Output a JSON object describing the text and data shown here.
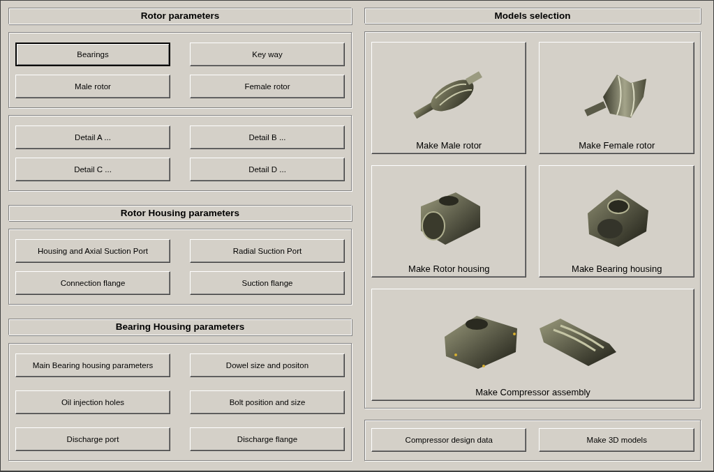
{
  "left": [
    {
      "title": "Rotor parameters",
      "groups": [
        [
          {
            "label": "Bearings",
            "default": true
          },
          {
            "label": "Key way",
            "default": false
          },
          {
            "label": "Male rotor",
            "default": false
          },
          {
            "label": "Female rotor",
            "default": false
          }
        ],
        [
          {
            "label": "Detail A ...",
            "default": false
          },
          {
            "label": "Detail B ...",
            "default": false
          },
          {
            "label": "Detail C ...",
            "default": false
          },
          {
            "label": "Detail D ...",
            "default": false
          }
        ]
      ]
    },
    {
      "title": "Rotor Housing parameters",
      "groups": [
        [
          {
            "label": "Housing and Axial Suction Port",
            "default": false
          },
          {
            "label": "Radial Suction Port",
            "default": false
          },
          {
            "label": "Connection flange",
            "default": false
          },
          {
            "label": "Suction flange",
            "default": false
          }
        ]
      ]
    },
    {
      "title": "Bearing Housing parameters",
      "groups": [
        [
          {
            "label": "Main Bearing housing parameters",
            "default": false
          },
          {
            "label": "Dowel size and positon",
            "default": false
          },
          {
            "label": "Oil injection holes",
            "default": false
          },
          {
            "label": "Bolt position and size",
            "default": false
          },
          {
            "label": "Discharge port",
            "default": false
          },
          {
            "label": "Discharge flange",
            "default": false
          }
        ]
      ]
    }
  ],
  "models": {
    "title": "Models selection",
    "tiles": [
      {
        "label": "Make Male rotor",
        "kind": "male_rotor"
      },
      {
        "label": "Make Female rotor",
        "kind": "female_rotor"
      },
      {
        "label": "Make Rotor housing",
        "kind": "rotor_housing"
      },
      {
        "label": "Make Bearing housing",
        "kind": "bearing_housing"
      },
      {
        "label": "Make Compressor assembly",
        "kind": "assembly"
      }
    ]
  },
  "bottom_buttons": [
    {
      "label": "Compressor design data",
      "default": false
    },
    {
      "label": "Make 3D models",
      "default": false
    }
  ]
}
